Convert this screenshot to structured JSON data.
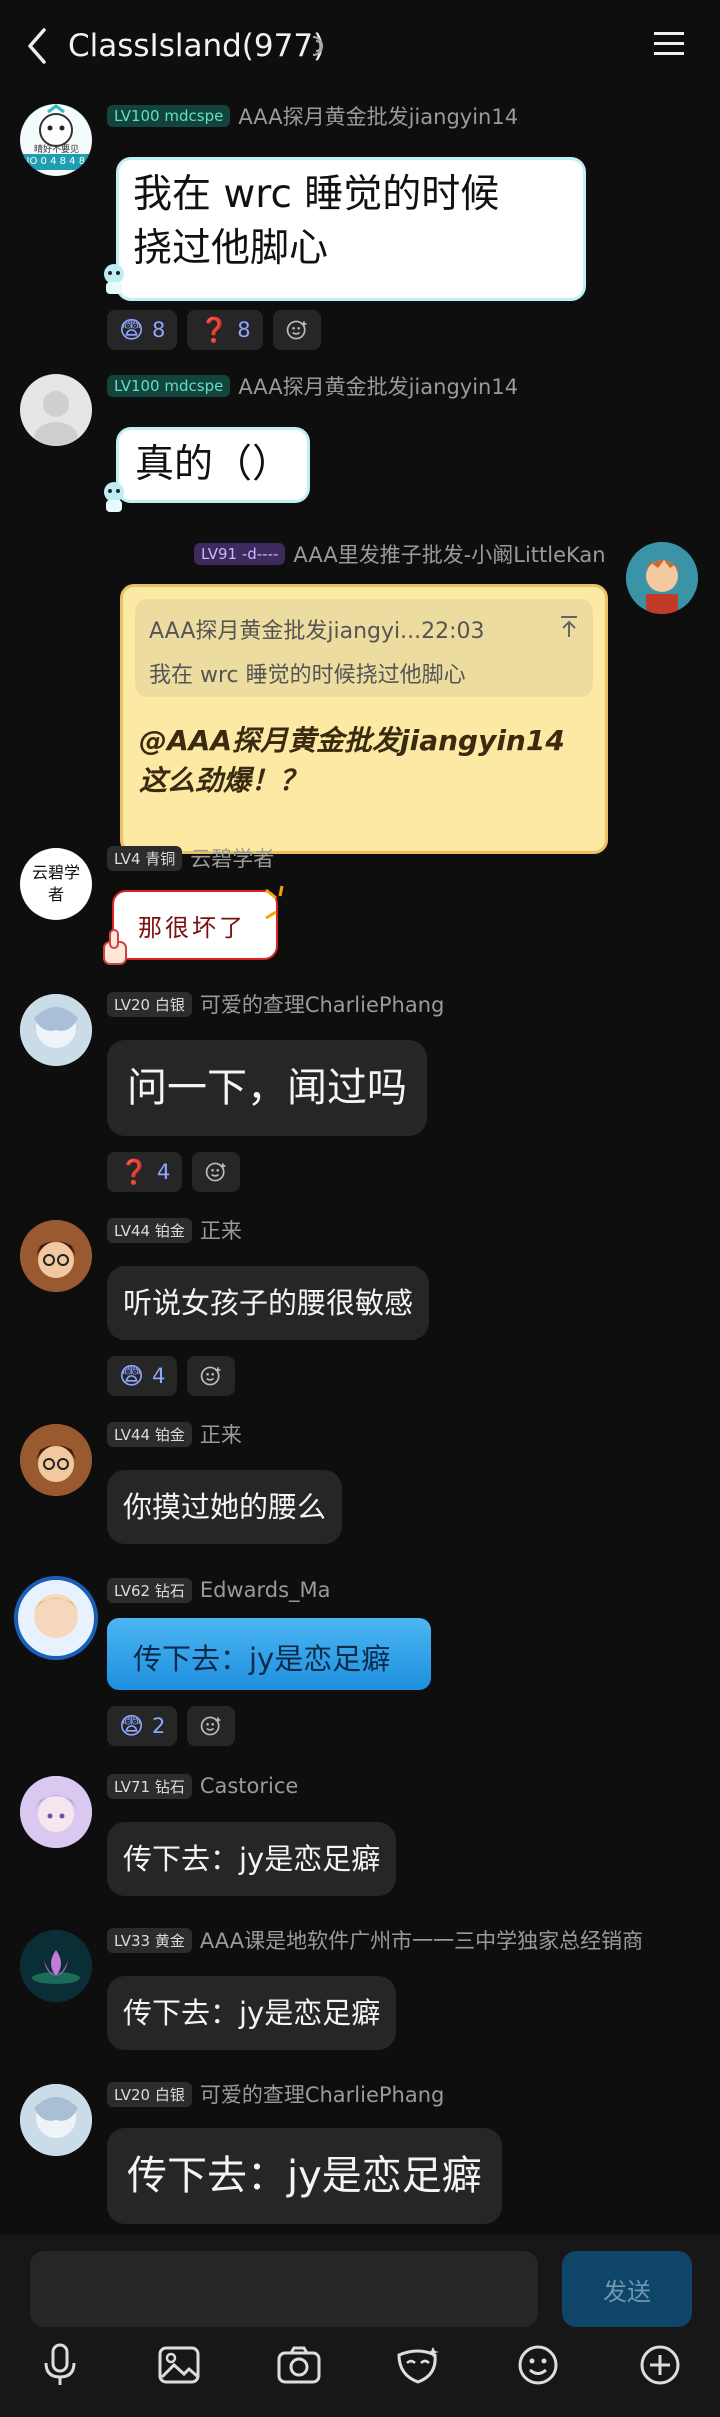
{
  "header": {
    "title": "ClassIsland(977)"
  },
  "messages": [
    {
      "level": "LV100 mdcspe",
      "name": "AAA探月黄金批发jiangyin14",
      "avatar_badge": "NO 0 4 8 4 8 4",
      "avatar_caption": "晴好不要见",
      "lines": [
        "我在 wrc 睡觉的时候",
        "挠过他脚心"
      ],
      "reactions": [
        {
          "emoji": "😨",
          "count": "8"
        },
        {
          "emoji": "❓",
          "count": "8"
        }
      ]
    },
    {
      "level": "LV100 mdcspe",
      "name": "AAA探月黄金批发jiangyin14",
      "text": "真的（）"
    },
    {
      "level": "LV91 -d----",
      "name": "AAA里发推子批发-小阚LittleKan",
      "quote_head": "AAA探月黄金批发jiangyi...22:03",
      "quote_text": "我在 wrc 睡觉的时候挠过他脚心",
      "lines": [
        "@AAA探月黄金批发jiangyin14",
        "这么劲爆！？"
      ]
    },
    {
      "level": "LV4 青铜",
      "name": "云碧学者",
      "avatar_text": "云碧学者",
      "text": "那很坏了"
    },
    {
      "level": "LV20 白银",
      "name": "可爱的查理CharliePhang",
      "text": "问一下，闻过吗",
      "reactions": [
        {
          "emoji": "❓",
          "count": "4"
        }
      ]
    },
    {
      "level": "LV44 铂金",
      "name": "正来",
      "text": "听说女孩子的腰很敏感",
      "reactions": [
        {
          "emoji": "😨",
          "count": "4"
        }
      ]
    },
    {
      "level": "LV44 铂金",
      "name": "正来",
      "text": "你摸过她的腰么"
    },
    {
      "level": "LV62 钻石",
      "name": "Edwards_Ma",
      "text": "传下去：jy是恋足癖",
      "reactions": [
        {
          "emoji": "😨",
          "count": "2"
        }
      ]
    },
    {
      "level": "LV71 钻石",
      "name": "Castorice",
      "text": "传下去：jy是恋足癖"
    },
    {
      "level": "LV33 黄金",
      "name": "AAA课是地软件广州市一一三中学独家总经销商",
      "text": "传下去：jy是恋足癖"
    },
    {
      "level": "LV20 白银",
      "name": "可爱的查理CharliePhang",
      "text": "传下去：jy是恋足癖"
    }
  ],
  "input": {
    "send_label": "发送"
  },
  "colors": {
    "background": "#0e0e0e",
    "bubble": "#262626",
    "accent": "#0e4568",
    "reaction_count": "#8fa6ff",
    "quote_card": "#fbe9a4",
    "blue_bubble": "#2aa1ec"
  }
}
